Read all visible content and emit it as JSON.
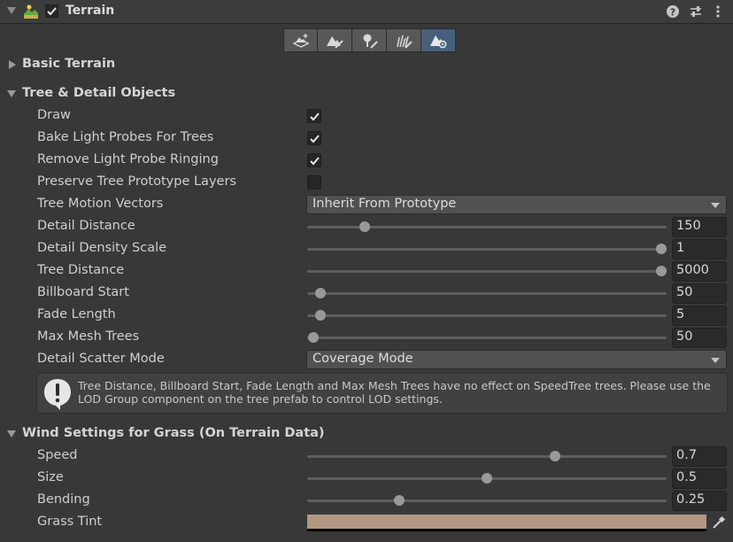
{
  "header": {
    "title": "Terrain",
    "component_enabled": true
  },
  "toolbar": {
    "tools": [
      {
        "icon": "terrain-paint-add-icon",
        "active": false
      },
      {
        "icon": "terrain-paint-brush-icon",
        "active": false
      },
      {
        "icon": "tree-paint-icon",
        "active": false
      },
      {
        "icon": "detail-paint-icon",
        "active": false
      },
      {
        "icon": "terrain-settings-icon",
        "active": true
      }
    ]
  },
  "sections": {
    "basic": {
      "title": "Basic Terrain",
      "expanded": false
    },
    "tree": {
      "title": "Tree & Detail Objects",
      "expanded": true
    },
    "wind": {
      "title": "Wind Settings for Grass (On Terrain Data)",
      "expanded": true
    }
  },
  "tree": {
    "draw": {
      "label": "Draw",
      "checked": true
    },
    "bake": {
      "label": "Bake Light Probes For Trees",
      "checked": true
    },
    "ringing": {
      "label": "Remove Light Probe Ringing",
      "checked": true
    },
    "preserve": {
      "label": "Preserve Tree Prototype Layers",
      "checked": false
    },
    "motion": {
      "label": "Tree Motion Vectors",
      "value": "Inherit From Prototype"
    },
    "detail_distance": {
      "label": "Detail Distance",
      "value": "150",
      "fraction": 0.16
    },
    "detail_density": {
      "label": "Detail Density Scale",
      "value": "1",
      "fraction": 0.985
    },
    "tree_distance": {
      "label": "Tree Distance",
      "value": "5000",
      "fraction": 0.985
    },
    "billboard_start": {
      "label": "Billboard Start",
      "value": "50",
      "fraction": 0.036
    },
    "fade_length": {
      "label": "Fade Length",
      "value": "5",
      "fraction": 0.038
    },
    "max_mesh": {
      "label": "Max Mesh Trees",
      "value": "50",
      "fraction": 0.018
    },
    "scatter": {
      "label": "Detail Scatter Mode",
      "value": "Coverage Mode"
    }
  },
  "help": {
    "text": "Tree Distance, Billboard Start, Fade Length and Max Mesh Trees have no effect on SpeedTree trees. Please use the LOD Group component on the tree prefab to control LOD settings."
  },
  "wind": {
    "speed": {
      "label": "Speed",
      "value": "0.7",
      "fraction": 0.69
    },
    "size": {
      "label": "Size",
      "value": "0.5",
      "fraction": 0.5
    },
    "bending": {
      "label": "Bending",
      "value": "0.25",
      "fraction": 0.257
    },
    "tint": {
      "label": "Grass Tint",
      "color": "#b29883"
    }
  }
}
